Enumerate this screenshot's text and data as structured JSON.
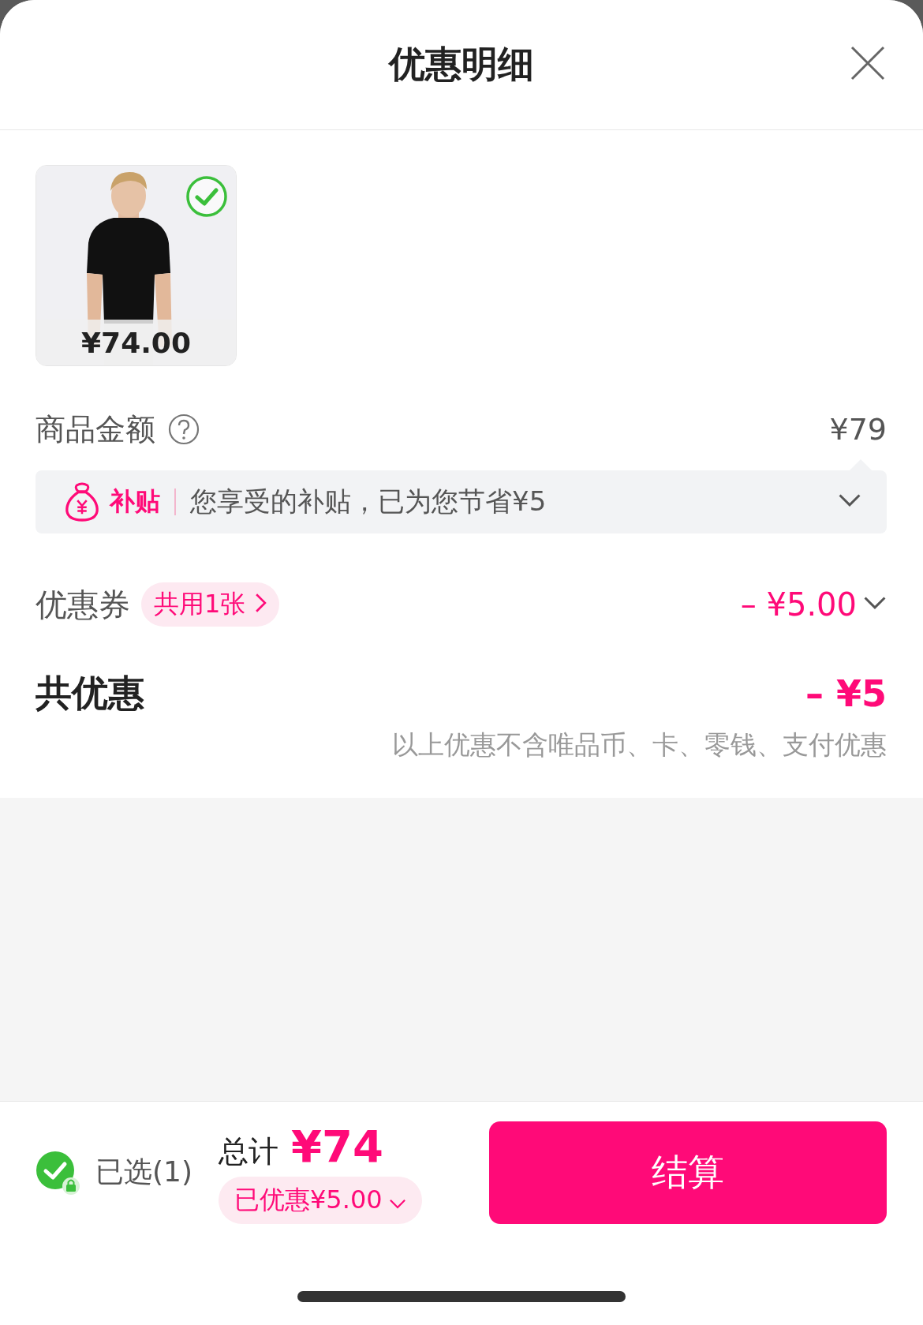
{
  "title": "优惠明细",
  "products": [
    {
      "price": "¥74.00",
      "selected": true,
      "kind": "picture"
    }
  ],
  "goods_amount": {
    "label": "商品金额",
    "value": "¥79"
  },
  "subsidy": {
    "tag": "补贴",
    "text": "您享受的补贴，已为您节省¥5",
    "expanded": false
  },
  "coupon": {
    "label": "优惠券",
    "badge": "共用1张",
    "value": "– ¥5.00"
  },
  "total_discount": {
    "label": "共优惠",
    "value": "– ¥5",
    "note": "以上优惠不含唯品币、卡、零钱、支付优惠"
  },
  "checkout": {
    "selected_label": "已选(1)",
    "all_selected": true,
    "total_label": "总计",
    "total": "¥74",
    "discount": "已优惠¥5.00",
    "button": "结算"
  }
}
